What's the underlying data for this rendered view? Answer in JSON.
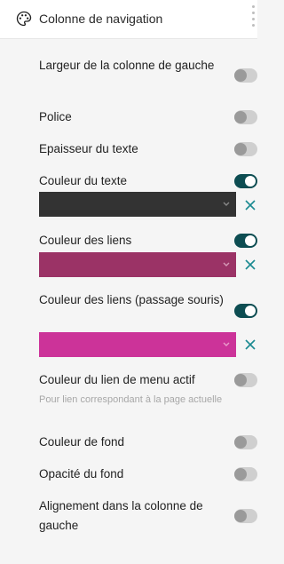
{
  "header": {
    "title": "Colonne de navigation"
  },
  "settings": [
    {
      "label": "Largeur de la colonne de gauche",
      "toggle": "off"
    },
    {
      "label": "Police",
      "toggle": "off"
    },
    {
      "label": "Epaisseur du texte",
      "toggle": "off"
    },
    {
      "label": "Couleur du texte",
      "toggle": "on",
      "color": "#333333"
    },
    {
      "label": "Couleur des liens",
      "toggle": "on",
      "color": "#9b3366"
    },
    {
      "label": "Couleur des liens (passage souris)",
      "toggle": "on",
      "color": "#cc3399"
    },
    {
      "label": "Couleur du lien de menu actif",
      "toggle": "off",
      "help": "Pour lien correspondant à la page actuelle"
    },
    {
      "label": "Couleur de fond",
      "toggle": "off"
    },
    {
      "label": "Opacité du fond",
      "toggle": "off"
    },
    {
      "label": "Alignement dans la colonne de gauche",
      "toggle": "off"
    }
  ],
  "colors": {
    "accent": "#0d4d52",
    "clear_icon": "#1b8a91"
  },
  "icons": {
    "header": "palette-icon",
    "menu": "drag-handle-icon",
    "select": "chevron-down-icon",
    "clear": "close-icon"
  }
}
